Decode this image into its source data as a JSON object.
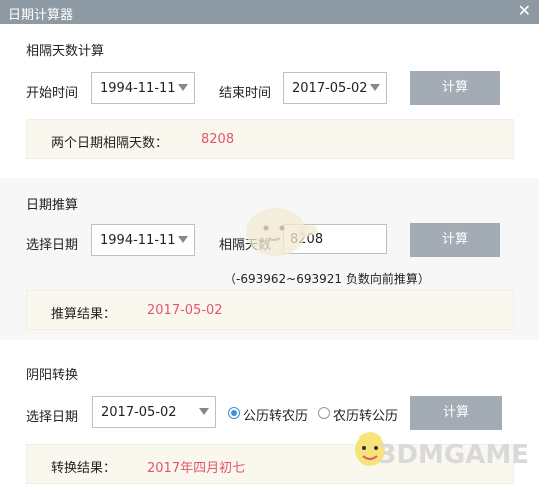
{
  "window": {
    "title": "日期计算器",
    "close_glyph": "✕"
  },
  "interval": {
    "heading": "相隔天数计算",
    "start_label": "开始时间",
    "start_value": "1994-11-11",
    "end_label": "结束时间",
    "end_value": "2017-05-02",
    "calc_label": "计算",
    "result_label": "两个日期相隔天数：",
    "result_value": "8208"
  },
  "extrapolate": {
    "heading": "日期推算",
    "date_label": "选择日期",
    "date_value": "1994-11-11",
    "days_label": "相隔天数",
    "days_value": "8208",
    "calc_label": "计算",
    "range_hint": "（-693962~693921 负数向前推算）",
    "result_label": "推算结果：",
    "result_value": "2017-05-02"
  },
  "lunar": {
    "heading": "阴阳转换",
    "date_label": "选择日期",
    "date_value": "2017-05-02",
    "option_solar_to_lunar": "公历转农历",
    "option_lunar_to_solar": "农历转公历",
    "selected_option": "公历转农历",
    "calc_label": "计算",
    "result_label": "转换结果：",
    "result_value": "2017年四月初七"
  },
  "watermark": {
    "text": "3DMGAME"
  },
  "colors": {
    "titlebar": "#8d9aa4",
    "button": "#a3acb4",
    "result_text": "#e0576b",
    "radio_accent": "#3a8fd9",
    "result_bg": "#faf8ee"
  }
}
